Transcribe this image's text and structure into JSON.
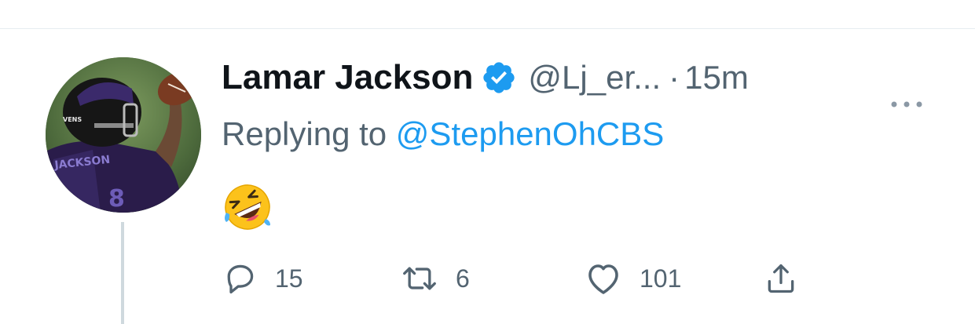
{
  "tweet": {
    "display_name": "Lamar Jackson",
    "handle": "@Lj_er...",
    "separator": "·",
    "time": "15m",
    "reply_prefix": "Replying to ",
    "reply_to": "@StephenOhCBS",
    "body_emoji": "🤣",
    "verified": true
  },
  "actions": {
    "reply_count": "15",
    "retweet_count": "6",
    "like_count": "101"
  },
  "avatar": {
    "jersey_text": "JACKSON",
    "helmet_text": "VENS"
  },
  "colors": {
    "name": "#0f1419",
    "secondary": "#536471",
    "link": "#1d9bf0",
    "verified": "#1d9bf0",
    "divider": "#e6ecf0",
    "thread_line": "#cfd9de"
  }
}
